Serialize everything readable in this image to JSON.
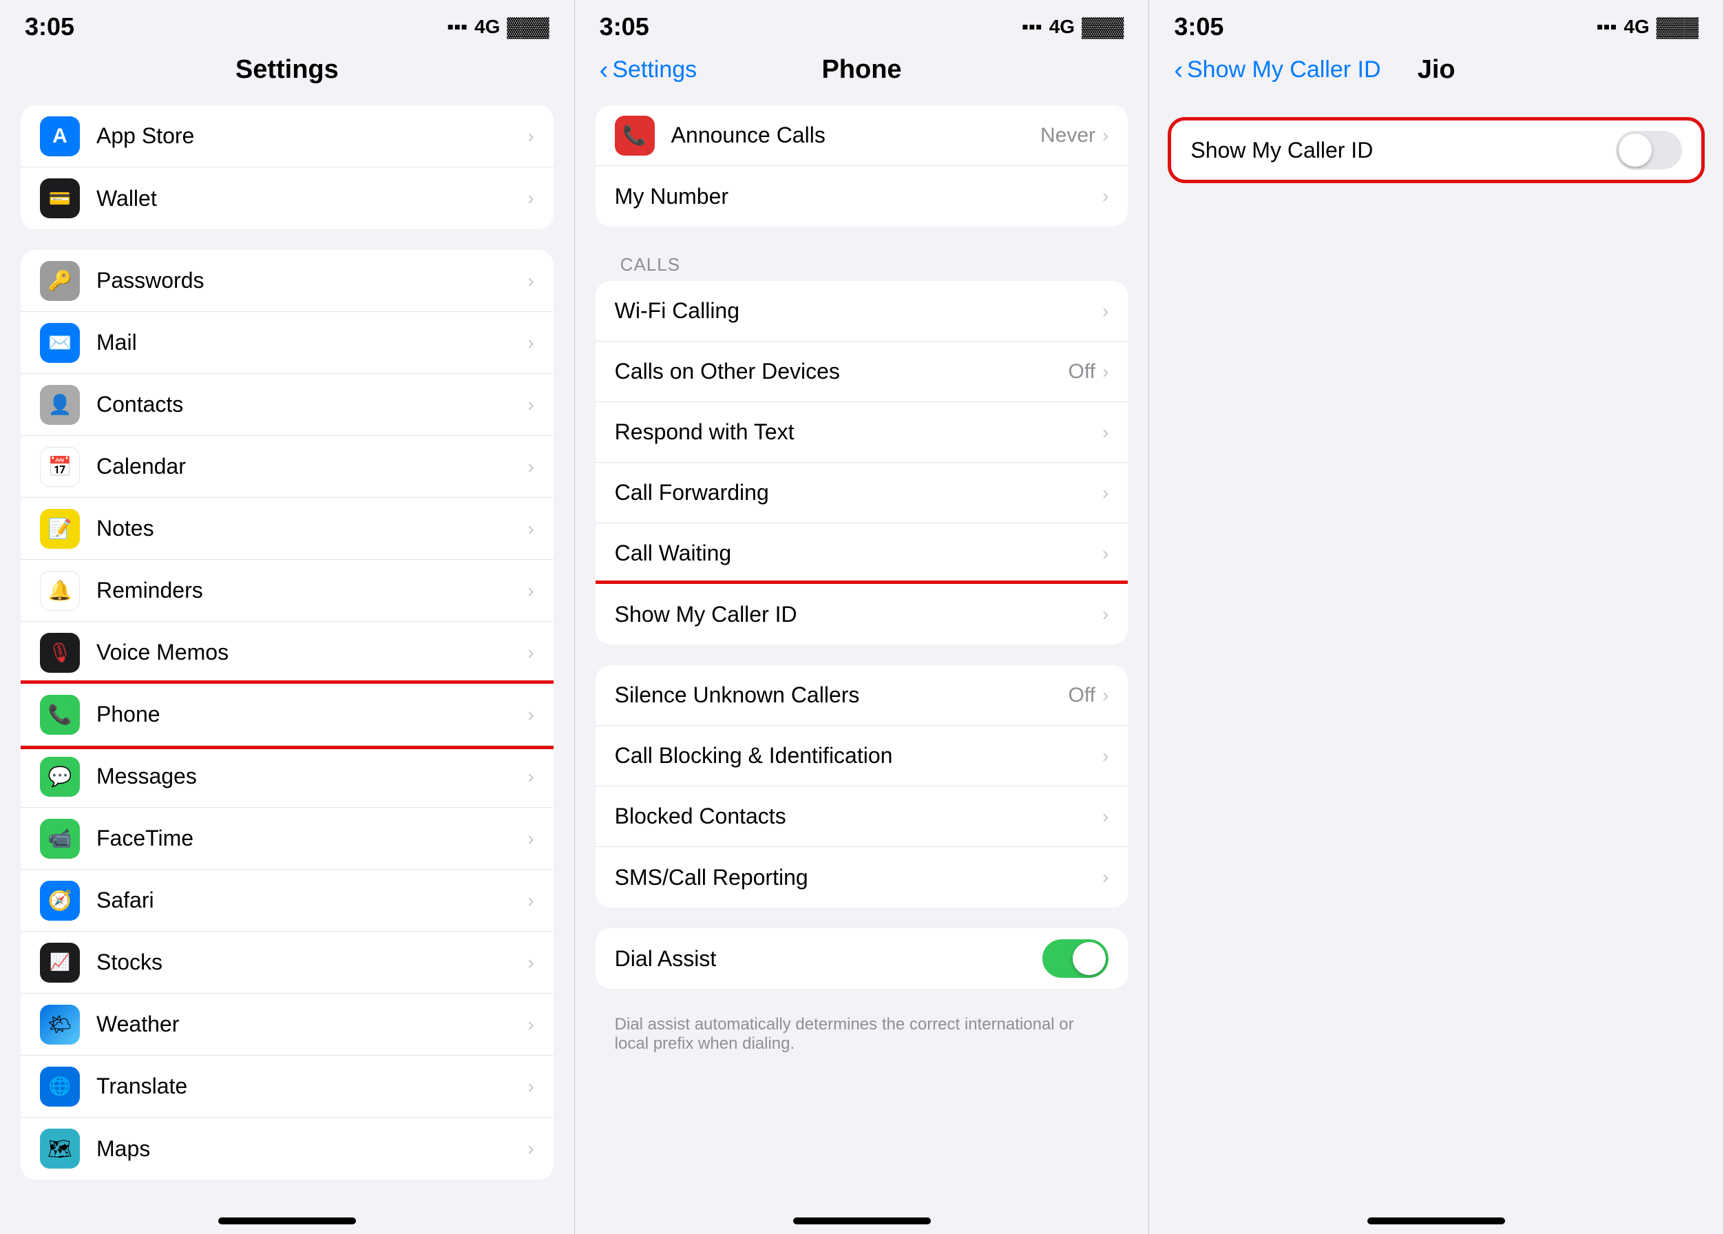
{
  "colors": {
    "accent": "#007aff",
    "green": "#34c759",
    "red": "#e01010",
    "gray": "#8e8e93",
    "separator": "#e5e5ea"
  },
  "panels": {
    "left": {
      "status": {
        "time": "3:05",
        "network": "4G"
      },
      "title": "Settings",
      "groups": [
        {
          "items": [
            {
              "id": "app-store",
              "label": "App Store",
              "icon_bg": "#007aff",
              "icon": "🅰"
            },
            {
              "id": "wallet",
              "label": "Wallet",
              "icon_bg": "#000",
              "icon": "💳"
            }
          ]
        },
        {
          "items": [
            {
              "id": "passwords",
              "label": "Passwords",
              "icon_bg": "#909090",
              "icon": "🔑"
            },
            {
              "id": "mail",
              "label": "Mail",
              "icon_bg": "#007aff",
              "icon": "✉️"
            },
            {
              "id": "contacts",
              "label": "Contacts",
              "icon_bg": "#aaaaaa",
              "icon": "👤"
            },
            {
              "id": "calendar",
              "label": "Calendar",
              "icon_bg": "#fff",
              "icon": "📅"
            },
            {
              "id": "notes",
              "label": "Notes",
              "icon_bg": "#f5d900",
              "icon": "📝"
            },
            {
              "id": "reminders",
              "label": "Reminders",
              "icon_bg": "#fff",
              "icon": "🔔"
            },
            {
              "id": "voice-memos",
              "label": "Voice Memos",
              "icon_bg": "#1c1c1e",
              "icon": "🎙"
            },
            {
              "id": "phone",
              "label": "Phone",
              "icon_bg": "#34c759",
              "icon": "📞"
            },
            {
              "id": "messages",
              "label": "Messages",
              "icon_bg": "#34c759",
              "icon": "💬"
            },
            {
              "id": "facetime",
              "label": "FaceTime",
              "icon_bg": "#34c759",
              "icon": "📹"
            },
            {
              "id": "safari",
              "label": "Safari",
              "icon_bg": "#007aff",
              "icon": "🧭"
            },
            {
              "id": "stocks",
              "label": "Stocks",
              "icon_bg": "#1c1c1e",
              "icon": "📈"
            },
            {
              "id": "weather",
              "label": "Weather",
              "icon_bg": "#0071e3",
              "icon": "🌤"
            },
            {
              "id": "translate",
              "label": "Translate",
              "icon_bg": "#0071e3",
              "icon": "🌐"
            },
            {
              "id": "maps",
              "label": "Maps",
              "icon_bg": "#30b0c7",
              "icon": "🗺"
            }
          ]
        }
      ]
    },
    "middle": {
      "status": {
        "time": "3:05",
        "network": "4G"
      },
      "back_label": "Settings",
      "title": "Phone",
      "sections": [
        {
          "items": [
            {
              "id": "announce-calls",
              "label": "Announce Calls",
              "value": "Never",
              "has_icon": true
            },
            {
              "id": "my-number",
              "label": "My Number",
              "value": ""
            }
          ]
        },
        {
          "section_label": "CALLS",
          "items": [
            {
              "id": "wifi-calling",
              "label": "Wi-Fi Calling",
              "value": ""
            },
            {
              "id": "calls-other-devices",
              "label": "Calls on Other Devices",
              "value": "Off"
            },
            {
              "id": "respond-text",
              "label": "Respond with Text",
              "value": ""
            },
            {
              "id": "call-forwarding",
              "label": "Call Forwarding",
              "value": ""
            },
            {
              "id": "call-waiting",
              "label": "Call Waiting",
              "value": ""
            },
            {
              "id": "show-caller-id",
              "label": "Show My Caller ID",
              "value": "",
              "highlighted": true
            }
          ]
        },
        {
          "items": [
            {
              "id": "silence-unknown",
              "label": "Silence Unknown Callers",
              "value": "Off"
            },
            {
              "id": "call-blocking",
              "label": "Call Blocking & Identification",
              "value": ""
            },
            {
              "id": "blocked-contacts",
              "label": "Blocked Contacts",
              "value": ""
            },
            {
              "id": "sms-reporting",
              "label": "SMS/Call Reporting",
              "value": ""
            }
          ]
        },
        {
          "items": [
            {
              "id": "dial-assist",
              "label": "Dial Assist",
              "value": "",
              "has_toggle": true,
              "toggle_on": true
            }
          ],
          "description": "Dial assist automatically determines the correct international or local prefix when dialing."
        }
      ]
    },
    "right": {
      "status": {
        "time": "3:05",
        "network": "4G"
      },
      "back_label": "Show My Caller ID",
      "title": "Jio",
      "items": [
        {
          "id": "show-caller-id-toggle",
          "label": "Show My Caller ID",
          "toggle_on": false,
          "highlighted": true
        }
      ]
    }
  }
}
